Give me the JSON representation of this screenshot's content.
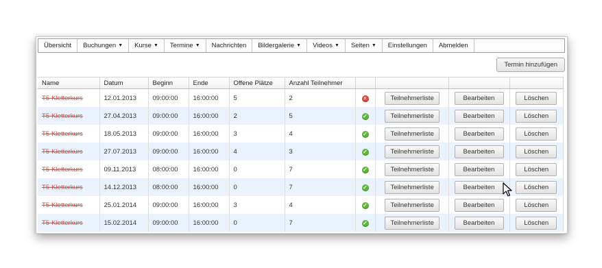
{
  "menu": [
    {
      "label": "Übersicht",
      "dropdown": false
    },
    {
      "label": "Buchungen",
      "dropdown": true
    },
    {
      "label": "Kurse",
      "dropdown": true
    },
    {
      "label": "Termine",
      "dropdown": true
    },
    {
      "label": "Nachrichten",
      "dropdown": false
    },
    {
      "label": "Bildergalerie",
      "dropdown": true
    },
    {
      "label": "Videos",
      "dropdown": true
    },
    {
      "label": "Seiten",
      "dropdown": true
    },
    {
      "label": "Einstellungen",
      "dropdown": false
    },
    {
      "label": "Abmelden",
      "dropdown": false
    }
  ],
  "add_button": "Termin hinzufügen",
  "columns": [
    "Name",
    "Datum",
    "Beginn",
    "Ende",
    "Offene Plätze",
    "Anzahl Teilnehmer",
    "",
    "",
    ""
  ],
  "buttons": {
    "list": "Teilnehmerliste",
    "edit": "Bearbeiten",
    "delete": "Löschen"
  },
  "status_colors": {
    "ok": "#5bb834",
    "bad": "#e2453a"
  },
  "rows": [
    {
      "name": "T5-Kletterkurs",
      "date": "12.01.2013",
      "start": "09:00:00",
      "end": "16:00:00",
      "open": "5",
      "participants": "2",
      "status": "bad"
    },
    {
      "name": "T5-Kletterkurs",
      "date": "27.04.2013",
      "start": "09:00:00",
      "end": "16:00:00",
      "open": "2",
      "participants": "5",
      "status": "ok"
    },
    {
      "name": "T5-Kletterkurs",
      "date": "18.05.2013",
      "start": "09:00:00",
      "end": "16:00:00",
      "open": "3",
      "participants": "4",
      "status": "ok"
    },
    {
      "name": "T5-Kletterkurs",
      "date": "27.07.2013",
      "start": "09:00:00",
      "end": "16:00:00",
      "open": "4",
      "participants": "3",
      "status": "ok"
    },
    {
      "name": "T5-Kletterkurs",
      "date": "09.11.2013",
      "start": "08:00:00",
      "end": "16:00:00",
      "open": "0",
      "participants": "7",
      "status": "ok"
    },
    {
      "name": "T5-Kletterkurs",
      "date": "14.12.2013",
      "start": "08:00:00",
      "end": "16:00:00",
      "open": "0",
      "participants": "7",
      "status": "ok"
    },
    {
      "name": "T5-Kletterkurs",
      "date": "25.01.2014",
      "start": "09:00:00",
      "end": "16:00:00",
      "open": "3",
      "participants": "4",
      "status": "ok"
    },
    {
      "name": "T5-Kletterkurs",
      "date": "15.02.2014",
      "start": "09:00:00",
      "end": "16:00:00",
      "open": "0",
      "participants": "7",
      "status": "ok"
    }
  ]
}
